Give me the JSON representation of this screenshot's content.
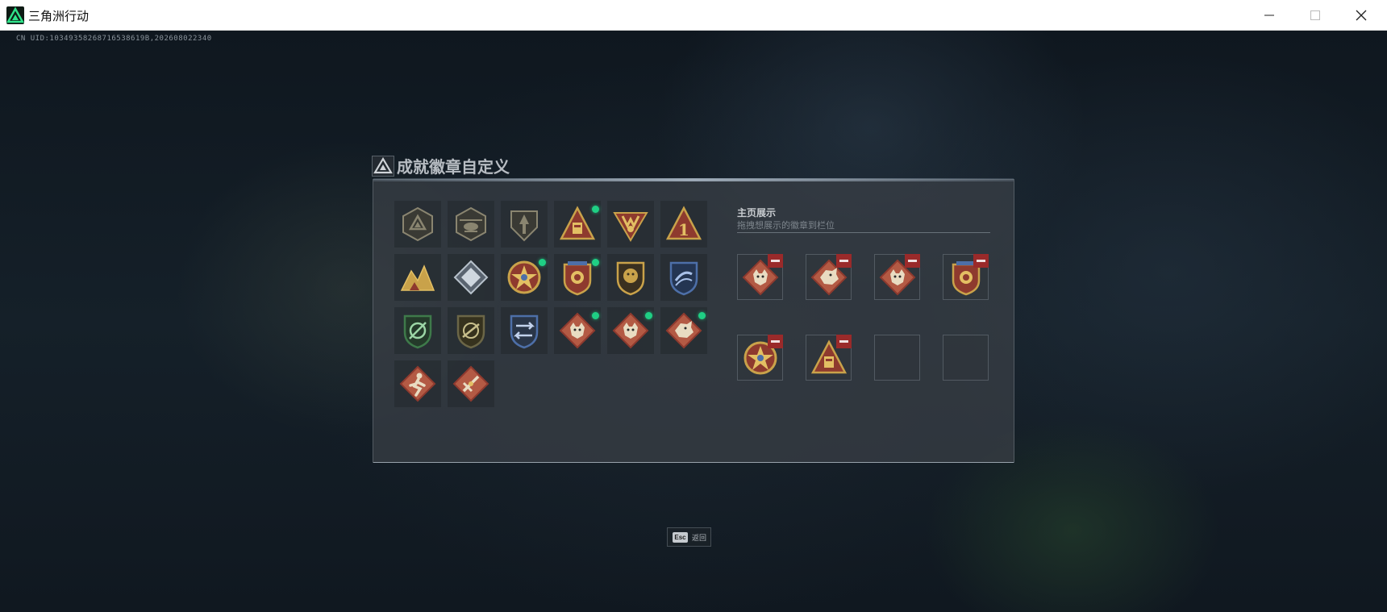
{
  "window": {
    "title": "三角洲行动"
  },
  "game": {
    "uid_text": "CN UID:10349358268716538619B,202608022340",
    "panel": {
      "title": "成就徽章自定义",
      "display_title": "主页展示",
      "display_hint": "拖拽想展示的徽章到栏位"
    },
    "badges": [
      {
        "icon": "triangle-badge-grey-icon",
        "new": false
      },
      {
        "icon": "helicopter-badge-grey-icon",
        "new": false
      },
      {
        "icon": "arrow-badge-grey-icon",
        "new": false
      },
      {
        "icon": "gold-triangle-badge-icon",
        "new": true
      },
      {
        "icon": "gold-fist-badge-icon",
        "new": false
      },
      {
        "icon": "gold-number-one-badge-icon",
        "new": false
      },
      {
        "icon": "gold-mountain-badge-icon",
        "new": false
      },
      {
        "icon": "silver-diamond-badge-icon",
        "new": false
      },
      {
        "icon": "red-star-medal-badge-icon",
        "new": true
      },
      {
        "icon": "red-shield-medal-badge-icon",
        "new": true
      },
      {
        "icon": "lion-shield-badge-icon",
        "new": false
      },
      {
        "icon": "blue-crest-badge-icon",
        "new": false
      },
      {
        "icon": "green-crest-badge-icon",
        "new": false
      },
      {
        "icon": "olive-crest-badge-icon",
        "new": false
      },
      {
        "icon": "blue-arrows-badge-icon",
        "new": false
      },
      {
        "icon": "red-wolf-diamond-badge-icon",
        "new": true
      },
      {
        "icon": "red-wolf-diamond-badge-icon",
        "new": true
      },
      {
        "icon": "red-dragon-diamond-badge-icon",
        "new": true
      },
      {
        "icon": "red-runner-diamond-badge-icon",
        "new": false
      },
      {
        "icon": "red-sword-diamond-badge-icon",
        "new": false
      }
    ],
    "display_slots": [
      {
        "icon": "red-wolf-diamond-badge-icon",
        "filled": true
      },
      {
        "icon": "red-dragon-diamond-badge-icon",
        "filled": true
      },
      {
        "icon": "red-wolf-diamond-badge-icon",
        "filled": true
      },
      {
        "icon": "red-shield-medal-badge-icon",
        "filled": true
      },
      {
        "icon": "red-star-medal-badge-icon",
        "filled": true
      },
      {
        "icon": "gold-triangle-badge-icon",
        "filled": true
      },
      {
        "icon": "",
        "filled": false
      },
      {
        "icon": "",
        "filled": false
      }
    ],
    "esc": {
      "key": "Esc",
      "label": "返回"
    }
  }
}
